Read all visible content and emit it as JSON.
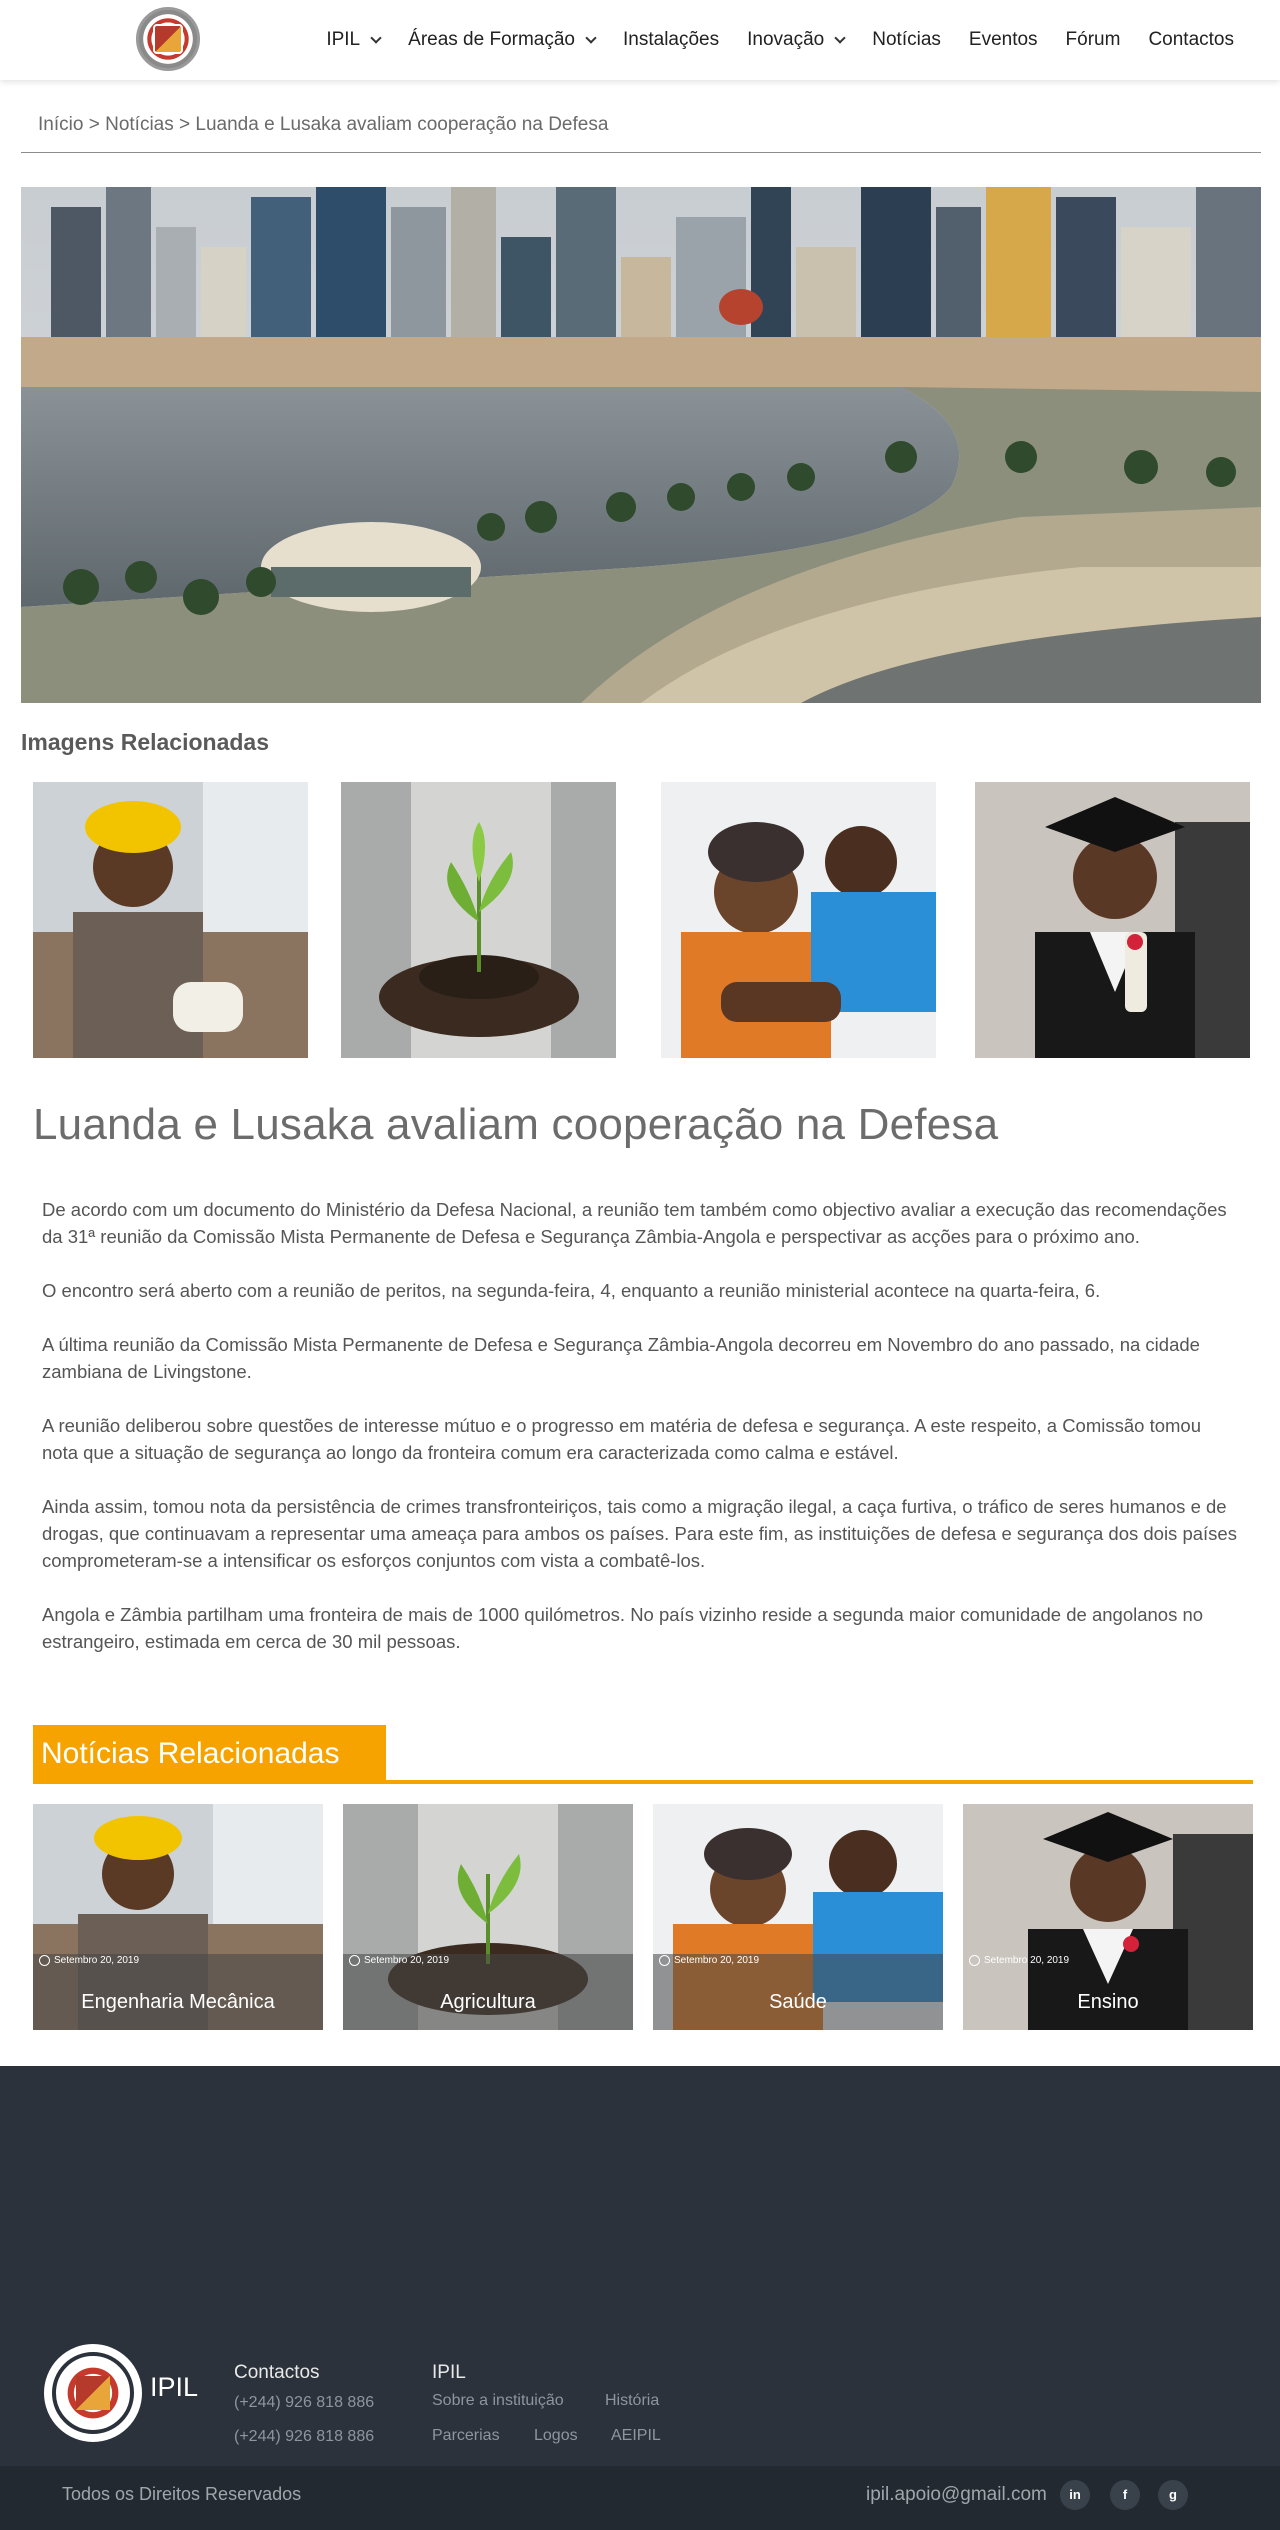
{
  "nav": {
    "items": [
      {
        "label": "IPIL",
        "dropdown": true
      },
      {
        "label": "Áreas de Formação",
        "dropdown": true
      },
      {
        "label": "Instalações",
        "dropdown": false
      },
      {
        "label": "Inovação",
        "dropdown": true
      },
      {
        "label": "Notícias",
        "dropdown": false
      },
      {
        "label": "Eventos",
        "dropdown": false
      },
      {
        "label": "Fórum",
        "dropdown": false
      },
      {
        "label": "Contactos",
        "dropdown": false
      }
    ]
  },
  "breadcrumb": {
    "home": "Início",
    "section": "Notícias",
    "current": "Luanda e Lusaka avaliam cooperação na Defesa",
    "separator": ">"
  },
  "related_images": {
    "title": "Imagens Relacionadas"
  },
  "article": {
    "title": "Luanda e Lusaka avaliam cooperação na Defesa",
    "paragraphs": [
      "De acordo com um documento do Ministério da Defesa Nacional, a reunião tem também como objectivo avaliar a execução das recomendações da 31ª reunião da Comissão Mista Permanente de Defesa e Segurança Zâmbia-Angola e perspectivar as acções para o próximo ano.",
      "O encontro será aberto com a reunião de peritos, na segunda-feira, 4, enquanto a reunião ministerial acontece na quarta-feira, 6.",
      "A última reunião da Comissão Mista Permanente de Defesa e Segurança Zâmbia-Angola decorreu em Novembro do ano passado, na cidade zambiana de Livingstone.",
      "A reunião deliberou sobre questões de interesse mútuo e o progresso em matéria de defesa e segurança. A este respeito, a Comissão tomou nota que a situação de segurança ao longo da fronteira comum era caracterizada como calma e estável.",
      "Ainda assim, tomou nota da persistência de crimes transfronteiriços, tais como a migração ilegal, a caça furtiva, o tráfico de seres humanos e de drogas, que continuavam a representar uma ameaça para ambos os países. Para este fim, as instituições de defesa e segurança dos dois países comprometeram-se a intensificar os esforços conjuntos com vista a combatê-los.",
      "Angola e Zâmbia partilham uma fronteira de mais de 1000 quilómetros. No país vizinho reside a segunda maior comunidade de angolanos no estrangeiro, estimada em cerca de 30 mil pessoas."
    ]
  },
  "related_news": {
    "title": "Notícias Relacionadas",
    "cards": [
      {
        "date": "Setembro 20, 2019",
        "label": "Engenharia Mecânica"
      },
      {
        "date": "Setembro 20, 2019",
        "label": "Agricultura"
      },
      {
        "date": "Setembro 20, 2019",
        "label": "Saúde"
      },
      {
        "date": "Setembro 20, 2019",
        "label": "Ensino"
      }
    ]
  },
  "footer": {
    "brand": "IPIL",
    "contacts": {
      "title": "Contactos",
      "phones": [
        "(+244) 926 818 886",
        "(+244) 926 818 886"
      ]
    },
    "ipil": {
      "title": "IPIL",
      "links": [
        "Sobre a instituição",
        "História",
        "Parcerias",
        "Logos",
        "AEIPIL"
      ]
    },
    "rights": "Todos os Direitos Reservados",
    "email": "ipil.apoio@gmail.com",
    "social": [
      "in",
      "f",
      "g"
    ]
  },
  "colors": {
    "accent": "#f6a300",
    "footer_bg": "#2b323c",
    "bottom_bar_bg": "#232931"
  }
}
